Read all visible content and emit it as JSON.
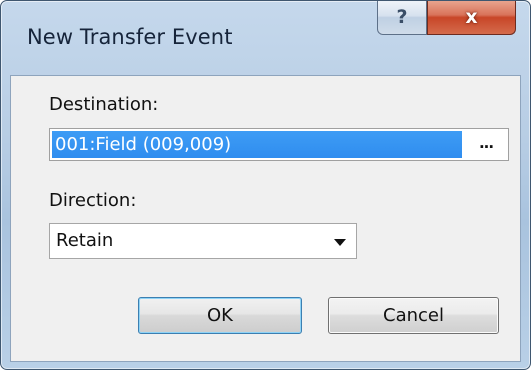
{
  "window": {
    "title": "New Transfer Event",
    "help_icon": "question-mark-icon",
    "help_glyph": "?",
    "close_icon": "close-x-icon",
    "close_glyph": "x"
  },
  "destination": {
    "label": "Destination:",
    "value": "001:Field (009,009)",
    "browse_label": "..."
  },
  "direction": {
    "label": "Direction:",
    "selected": "Retain",
    "dropdown_icon": "chevron-down-icon"
  },
  "buttons": {
    "ok_label": "OK",
    "cancel_label": "Cancel"
  },
  "colors": {
    "selection_highlight": "#3399ff",
    "close_button": "#c84628"
  }
}
